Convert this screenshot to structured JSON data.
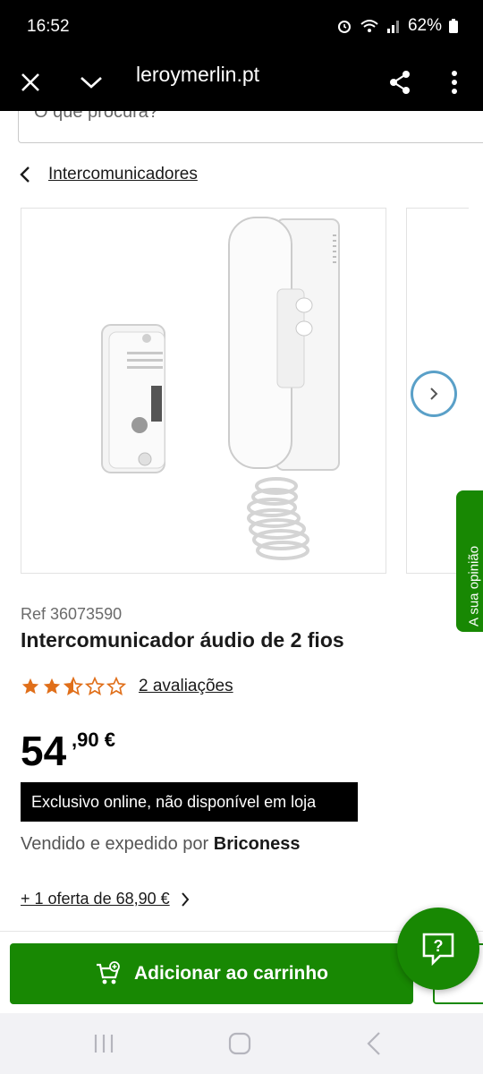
{
  "status": {
    "time": "16:52",
    "battery": "62%"
  },
  "browser": {
    "url": "leroymerlin.pt"
  },
  "search": {
    "placeholder": "O que procura?"
  },
  "breadcrumb": {
    "label": "Intercomunicadores"
  },
  "product": {
    "ref": "Ref 36073590",
    "title": "Intercomunicador áudio de 2 fios",
    "rating": 2.5,
    "reviews_label": "2 avaliações",
    "price_int": "54",
    "price_dec": ",90 €",
    "exclusive_label": "Exclusivo online, não disponível em loja",
    "seller_prefix": "Vendido e expedido por",
    "seller_name": "Briconess",
    "offer_label": "+ 1 oferta de 68,90 €"
  },
  "feedback": {
    "label": "A sua opinião"
  },
  "cart": {
    "label": "Adicionar ao carrinho"
  },
  "colors": {
    "brand_green": "#188803",
    "star": "#e06f1a"
  },
  "icons": [
    "close-icon",
    "chevron-down-icon",
    "share-icon",
    "more-vertical-icon",
    "chevron-left-icon",
    "chevron-right-icon",
    "star-icon",
    "cart-icon",
    "help-icon",
    "recents-icon",
    "home-icon",
    "back-icon"
  ]
}
